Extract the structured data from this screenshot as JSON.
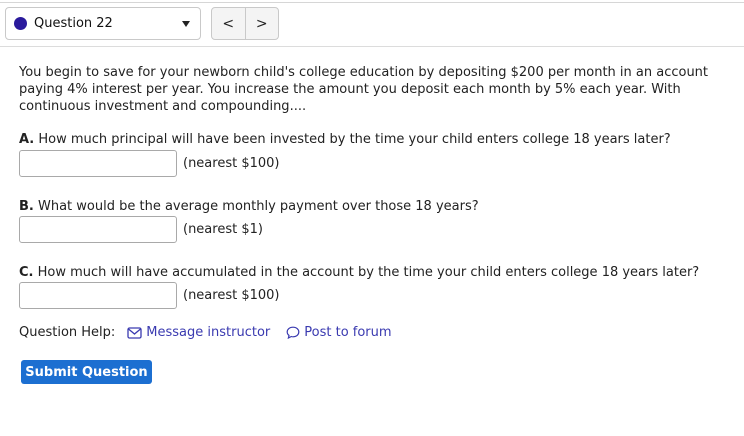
{
  "nav": {
    "question_label": "Question 22",
    "prev_label": "<",
    "next_label": ">"
  },
  "question": {
    "text": "You begin to save for your newborn child's college education by depositing $200 per month in an account paying 4% interest per year. You increase the amount you deposit each month by 5% each year. With continuous investment and compounding....",
    "parts": [
      {
        "prefix": "A.",
        "prompt": " How much principal will have been invested by the time your child enters college 18 years later?",
        "value": "",
        "hint": "(nearest $100)"
      },
      {
        "prefix": "B.",
        "prompt": " What would be the average monthly payment over those 18 years?",
        "value": "",
        "hint": "(nearest $1)"
      },
      {
        "prefix": "C.",
        "prompt": " How much will have accumulated in the account by the time your child enters college 18 years later?",
        "value": "",
        "hint": "(nearest $100)"
      }
    ]
  },
  "help": {
    "label": "Question Help:",
    "message_label": "Message instructor",
    "forum_label": "Post to forum"
  },
  "submit_label": "Submit Question",
  "colors": {
    "status_dot": "#2a1a9c",
    "link": "#3a3ab0",
    "submit_bg": "#1c6fd1"
  }
}
